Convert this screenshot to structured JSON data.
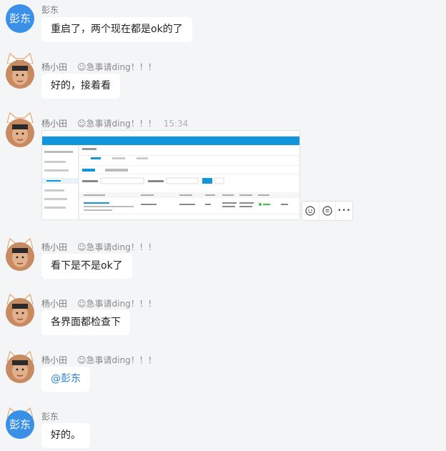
{
  "messages": [
    {
      "sender": "彭东",
      "avatar": "彭东",
      "text": "重启了，两个现在都是ok的了"
    },
    {
      "sender": "杨小田",
      "signature": "急事请ding！！！",
      "text": "好的，接着看"
    },
    {
      "sender": "杨小田",
      "signature": "急事请ding！！！",
      "time": "15:34"
    },
    {
      "sender": "杨小田",
      "signature": "急事请ding！！！",
      "text": "看下是不是ok了"
    },
    {
      "sender": "杨小田",
      "signature": "急事请ding！！！",
      "text": "各界面都检查下"
    },
    {
      "sender": "杨小田",
      "signature": "急事请ding！！！",
      "text": "@彭东"
    },
    {
      "sender": "彭东",
      "avatar": "彭东",
      "text": "好的。"
    }
  ],
  "toolbar": {
    "more_label": "•••"
  },
  "colors": {
    "accent": "#3a8fe6",
    "mention": "#2a7fd4"
  }
}
